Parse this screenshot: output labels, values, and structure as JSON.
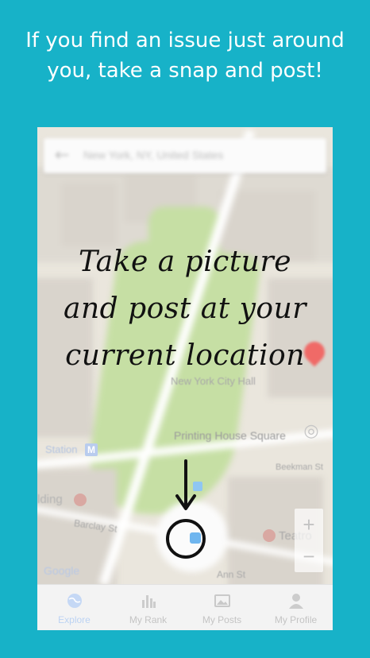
{
  "promo": {
    "headline_line1": "If you find an issue just around",
    "headline_line2": "you, take a snap and post!",
    "background_color": "#17b2c8"
  },
  "search": {
    "text": "New York, NY, United States",
    "back_icon": "arrow-back-icon"
  },
  "overlay": {
    "line1": "Take a picture",
    "line2": "and post at your",
    "line3": "current location"
  },
  "map": {
    "labels": {
      "city_hall": "New York City Hall",
      "printing_house": "Printing House Square",
      "station": "Station",
      "station_badge": "M",
      "beekman": "Beekman St",
      "building": "lding",
      "barclay": "Barclay St",
      "teatro": "Teatro",
      "ann": "Ann St",
      "google": "Google"
    },
    "pin_color": "#f06a67",
    "zoom_in": "+",
    "zoom_out": "−"
  },
  "tabs": [
    {
      "label": "Explore",
      "icon": "globe-icon",
      "active": true
    },
    {
      "label": "My Rank",
      "icon": "bar-chart-icon",
      "active": false
    },
    {
      "label": "My Posts",
      "icon": "gallery-icon",
      "active": false
    },
    {
      "label": "My Profile",
      "icon": "person-icon",
      "active": false
    }
  ]
}
